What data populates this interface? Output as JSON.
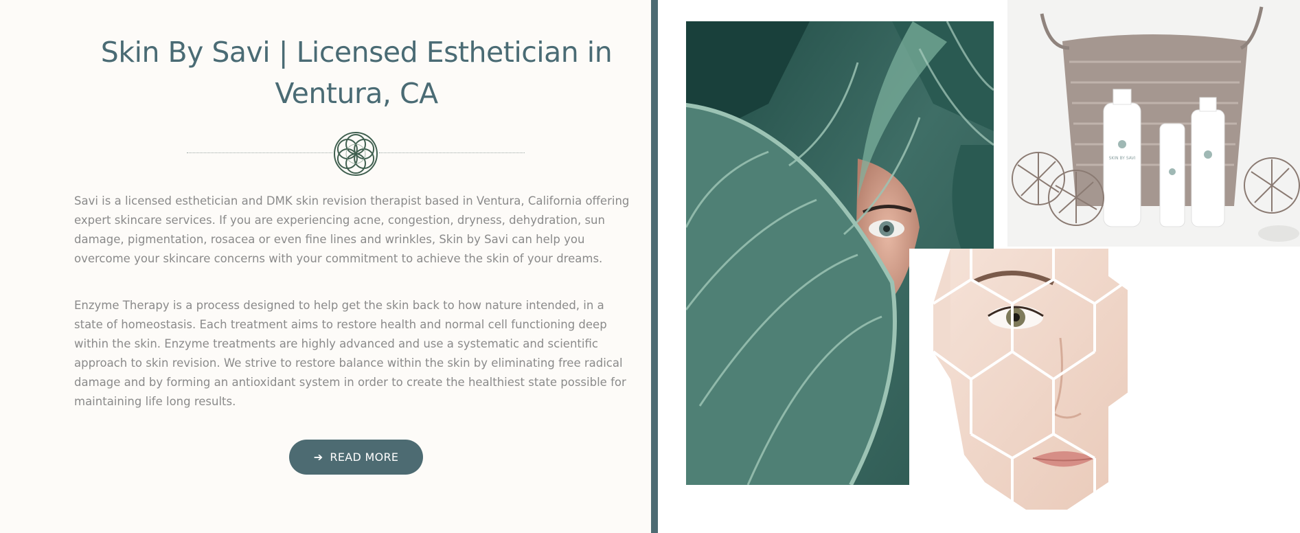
{
  "hero": {
    "title": "Skin By Savi | Licensed Esthetician in Ventura, CA",
    "paragraph_1": "Savi is a licensed esthetician and DMK skin revision therapist based in Ventura, California offering expert skincare services. If you are experiencing acne, congestion, dryness, dehydration, sun damage, pigmentation, rosacea or even fine lines and wrinkles, Skin by Savi can help you overcome your skincare concerns with your commitment to achieve the skin of your dreams.",
    "paragraph_2": "Enzyme Therapy is a process designed to help get the skin back to how nature intended, in a state of homeostasis. Each treatment aims to restore health and normal cell functioning deep within the skin. Enzyme treatments are highly advanced and use a systematic and scientific approach to skin revision. We strive to restore balance within the skin by eliminating free radical damage and by forming an antioxidant system in order to create the healthiest state possible for maintaining life long results.",
    "button_label": "READ MORE",
    "button_icon": "arrow-right-icon",
    "ornament_icon": "flower-of-life-icon"
  },
  "gallery": {
    "images": [
      "tropical-leaf-eye-photo",
      "product-basket-photo",
      "hexagon-face-photo"
    ],
    "product_label": "SKIN BY SAVI"
  },
  "colors": {
    "accent": "#4d6b72",
    "title": "#4a6b74",
    "body_text": "#8a8a8a",
    "background": "#fdfbf8",
    "ornament": "#3f5f4f"
  }
}
